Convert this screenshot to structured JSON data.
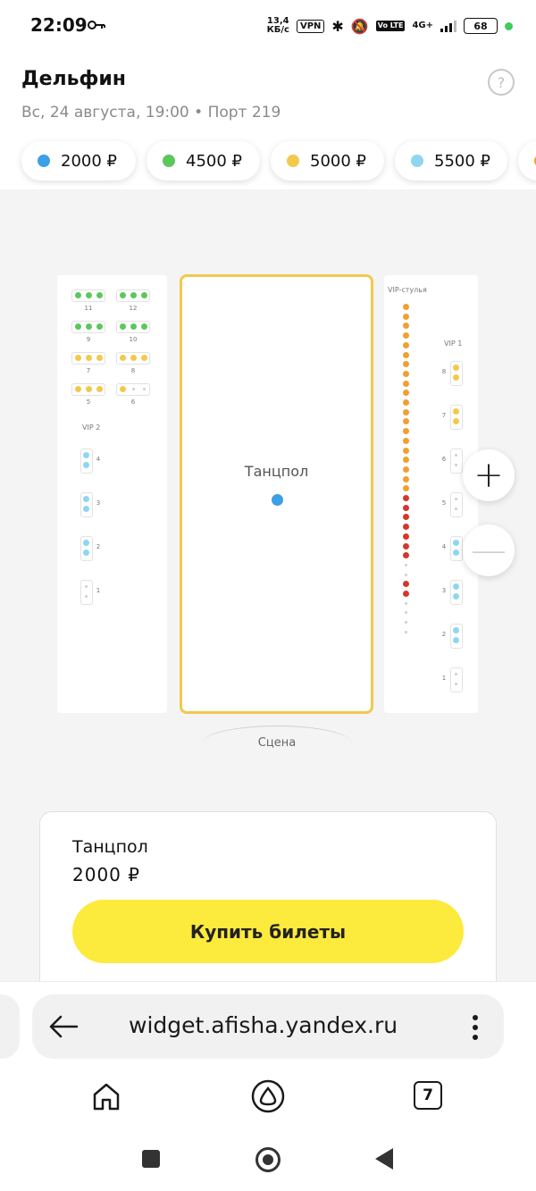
{
  "status_bar": {
    "time": "22:09",
    "net_speed_value": "13,4",
    "net_speed_unit": "КБ/с",
    "vpn": "VPN",
    "volte": "Vo LTE",
    "network": "4G+",
    "battery": "68",
    "icons": [
      "key-icon",
      "bluetooth-icon",
      "mute-icon",
      "signal-icon",
      "battery-icon"
    ]
  },
  "event": {
    "title": "Дельфин",
    "subtitle": "Вс, 24 августа, 19:00  •  Порт 219",
    "help": "?"
  },
  "price_filters": [
    {
      "label": "2000 ₽",
      "color": "#3d9fe8"
    },
    {
      "label": "4500 ₽",
      "color": "#5cc85c"
    },
    {
      "label": "5000 ₽",
      "color": "#f2c94c"
    },
    {
      "label": "5500 ₽",
      "color": "#8fd6f0"
    },
    {
      "label": "",
      "color": "#f0a030"
    }
  ],
  "hall": {
    "dancefloor_label": "Танцпол",
    "stage_label": "Сцена",
    "vip2_label": "VIP 2",
    "vip1_label": "VIP 1",
    "vip_chairs_label": "VIP-стулья",
    "left_table_numbers": [
      "11",
      "12",
      "9",
      "10",
      "7",
      "8",
      "5",
      "6"
    ],
    "vip2_numbers": [
      "4",
      "3",
      "2",
      "1"
    ],
    "vip1_numbers": [
      "8",
      "7",
      "6",
      "5",
      "4",
      "3",
      "2",
      "1"
    ],
    "zoom_in": "+",
    "zoom_out": "—"
  },
  "ticket": {
    "zone": "Танцпол",
    "price": "2000 ₽",
    "buy_label": "Купить билеты"
  },
  "browser": {
    "url": "widget.afisha.yandex.ru",
    "tabs_count": "7"
  },
  "colors": {
    "accent_yellow": "#fcea3d",
    "dancefloor_border": "#f2c94c",
    "sold_red": "#d6372b",
    "chair_orange": "#f0a030"
  }
}
